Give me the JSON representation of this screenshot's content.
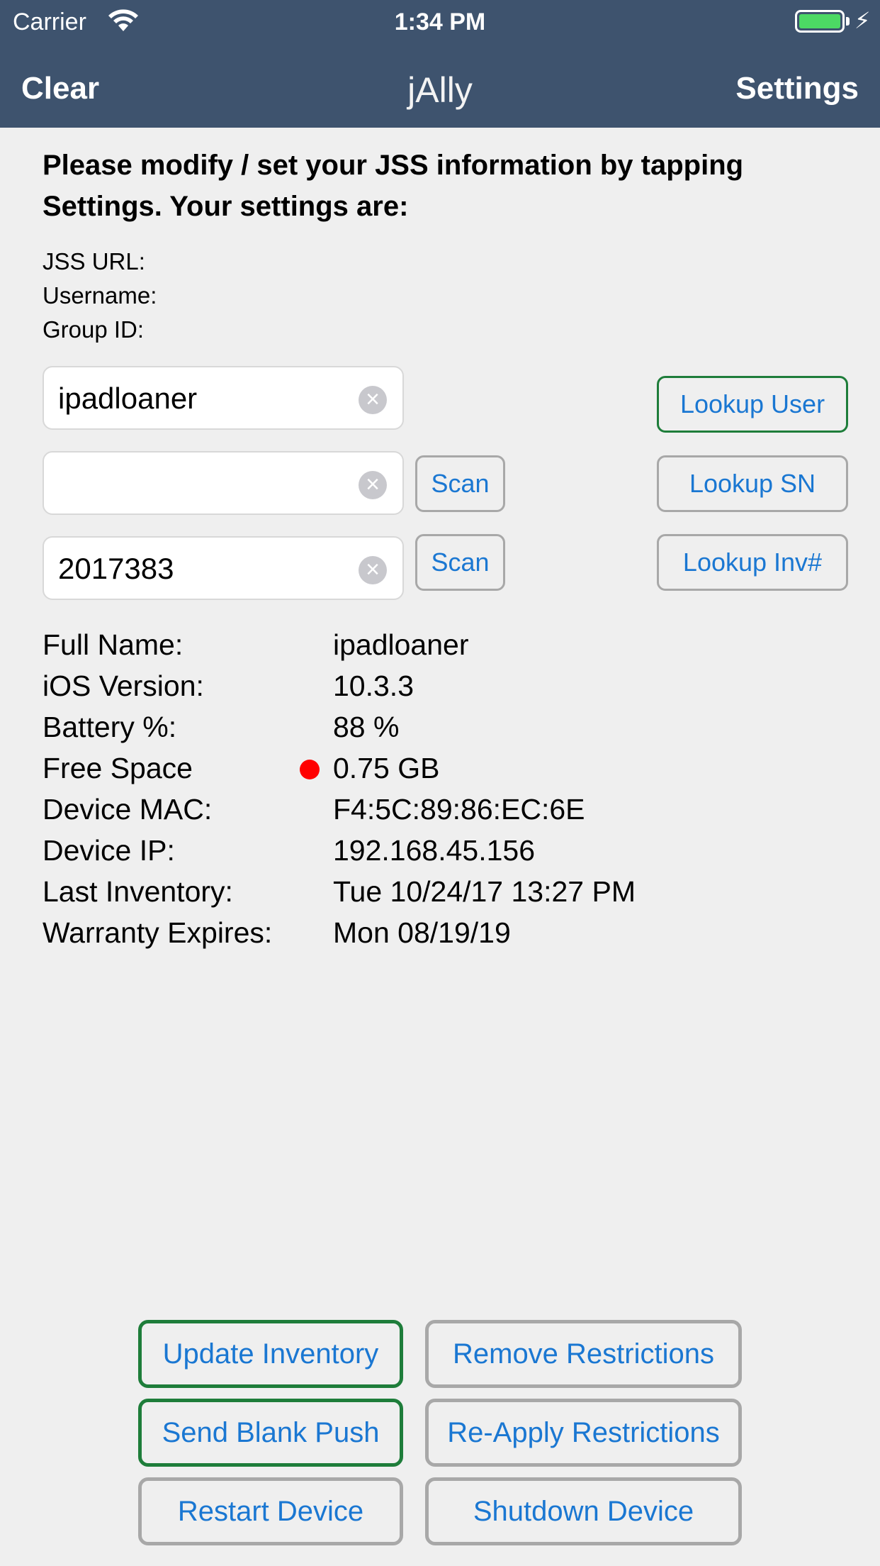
{
  "status_bar": {
    "carrier": "Carrier",
    "time": "1:34 PM",
    "battery_level": 1.0,
    "icons": [
      "wifi-icon",
      "battery-icon",
      "charging-bolt-icon"
    ]
  },
  "nav": {
    "left": "Clear",
    "title": "jAlly",
    "right": "Settings"
  },
  "intro": "Please modify / set your JSS information by tapping Settings. Your settings are:",
  "settings": {
    "jss_url_label": "JSS URL:",
    "username_label": "Username:",
    "group_id_label": "Group ID:"
  },
  "inputs": {
    "user_value": "ipadloaner",
    "serial_value": "",
    "inventory_value": "2017383"
  },
  "buttons": {
    "scan": "Scan",
    "lookup_user": "Lookup User",
    "lookup_sn": "Lookup SN",
    "lookup_inv": "Lookup Inv#"
  },
  "device_info": [
    {
      "label": "Full Name:",
      "value": "ipadloaner"
    },
    {
      "label": "iOS Version:",
      "value": "10.3.3"
    },
    {
      "label": "Battery %:",
      "value": "88 %"
    },
    {
      "label": "Free Space",
      "value": "0.75  GB"
    },
    {
      "label": "Device MAC:",
      "value": "F4:5C:89:86:EC:6E"
    },
    {
      "label": "Device IP:",
      "value": "192.168.45.156"
    },
    {
      "label": "Last Inventory:",
      "value": "Tue 10/24/17 13:27 PM"
    },
    {
      "label": "Warranty Expires:",
      "value": "Mon 08/19/19"
    }
  ],
  "actions": {
    "update_inventory": "Update Inventory",
    "remove_restrictions": "Remove Restrictions",
    "send_blank_push": "Send Blank Push",
    "reapply_restrictions": "Re-Apply Restrictions",
    "restart_device": "Restart Device",
    "shutdown_device": "Shutdown Device"
  },
  "colors": {
    "nav_bg": "#3e536e",
    "accent": "#1a77d2",
    "green_border": "#1e7d3a",
    "warning_dot": "#ff0000"
  }
}
